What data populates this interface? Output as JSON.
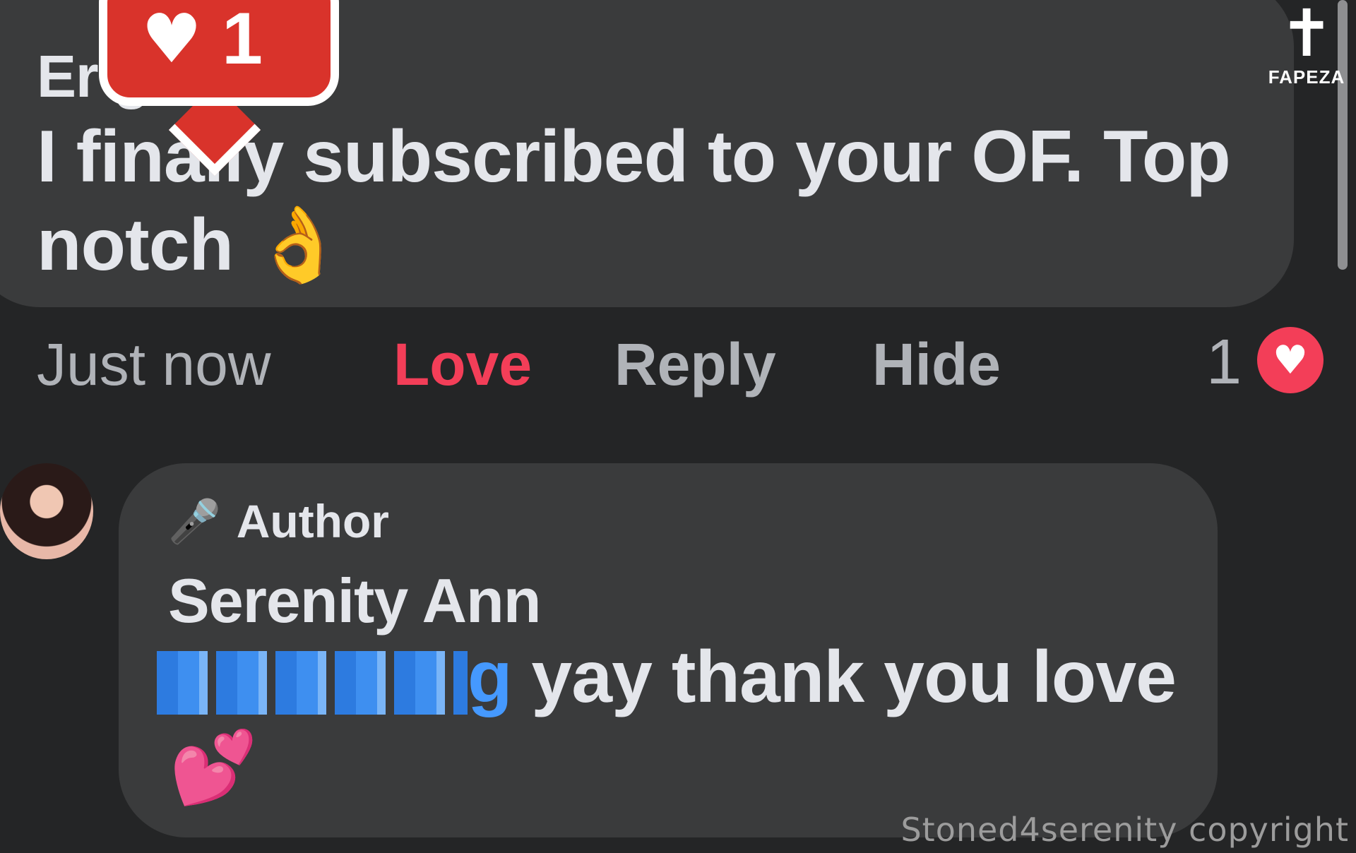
{
  "comment": {
    "author_visible": "Er                g",
    "text": "I finally subscribed to your OF. Top notch",
    "emoji": "👌"
  },
  "notification": {
    "icon": "heart-icon",
    "count": "1",
    "color": "#d9332b"
  },
  "actions": {
    "time": "Just now",
    "love": "Love",
    "reply": "Reply",
    "hide": "Hide",
    "reaction_count": "1",
    "love_color": "#f33e58"
  },
  "reply": {
    "badge": "Author",
    "name": "Serenity Ann",
    "mention_tail": "g",
    "text": " yay thank you love",
    "emoji": "💕",
    "mention_color": "#4599ff"
  },
  "branding": {
    "logo": "FAPEZA",
    "watermark": "Stoned4serenity copyright"
  }
}
